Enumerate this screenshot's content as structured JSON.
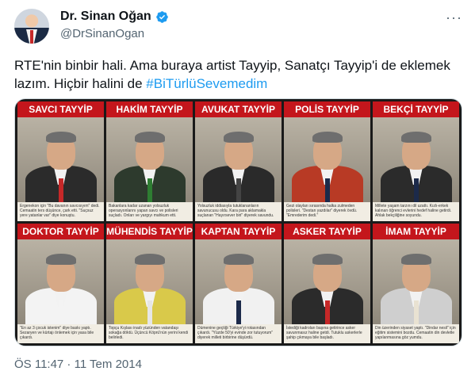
{
  "author": {
    "name": "Dr. Sinan Oğan",
    "handle": "@DrSinanOgan",
    "verified": true
  },
  "tweet": {
    "text": "RTE'nin binbir hali. Ama buraya artist Tayyip, Sanatçı Tayyip'i de eklemek lazım. Hiçbir halini de ",
    "hashtag": "#BiTürlüSevemedim",
    "timestamp": "ÖS 11:47 · 11 Tem 2014"
  },
  "media": {
    "panels": [
      {
        "label": "SAVCI TAYYİP",
        "caption": "Ergenekon için \"Bu davanın savcısıyım\" dedi. Cemaatin ters düşünce, çark etti. \"Suçsuz yere yatanlar var\" diye konuştu.",
        "body": "#2b2b2b",
        "accent": "#c62828"
      },
      {
        "label": "HAKİM TAYYİP",
        "caption": "Bakanlara kadar uzanan yolsuzluk operasyonlarını yapan savcı ve polisleri suçladı. Onları ve yargıyı mahkum etti.",
        "body": "#2d3a2d",
        "accent": "#2e7d32"
      },
      {
        "label": "AVUKAT TAYYİP",
        "caption": "Yolsuzluk iddiasıyla tutuklananların savunucusu oldu. Kara para aklamakla suçlanan \"Hayırsever biri\" diyerek savundu.",
        "body": "#2a2a2a",
        "accent": "#444444"
      },
      {
        "label": "POLİS TAYYİP",
        "caption": "Gezi olayları sırasında halka zulmeden polisleri. \"Destan yazdılar\" diyerek övdü. \"Emrederim dedi.\"",
        "body": "#b83a25",
        "accent": "#1c2a4a"
      },
      {
        "label": "BEKÇİ TAYYİP",
        "caption": "Millete yaşam tarzını dil uzattı. Kızlı-erkek kalınan öğrenci evlerini hedef haline getirdi. Ahlak bekçiliğine soyundu.",
        "body": "#2b2b2b",
        "accent": "#1c2a4a"
      },
      {
        "label": "DOKTOR TAYYİP",
        "caption": "\"En az 3 çocuk istenim\" diye baskı yaptı. Sezaryen ve kürtajı önlemek için yasa bile çıkardı.",
        "body": "#f3f3f3",
        "accent": "#f3f3f3"
      },
      {
        "label": "MÜHENDİS TAYYİP",
        "caption": "Topçu Kışlası inadı yüzünden vatandaşı sokağa döktü. Üçüncü Köprü'nün yerini kendi belirledi.",
        "body": "#d9c94a",
        "accent": "#e6e6e6"
      },
      {
        "label": "KAPTAN TAYYİP",
        "caption": "Dümenine geçtiği Türkiye'yi rotasından çıkardı. \"Yüzde 50'yi evinde zor tutuyorum\" diyerek milleti birbirine düşürdü.",
        "body": "#f1f1f1",
        "accent": "#1c2a4a"
      },
      {
        "label": "ASKER TAYYİP",
        "caption": "İstediği kadroları başına getirince asker savunmasız haline getdi. Tutuklu askerlerle şahip çıkmaya bile başladı.",
        "body": "#2b2b2b",
        "accent": "#c62828"
      },
      {
        "label": "İMAM TAYYİP",
        "caption": "Din üzerinden siyaset yaptı. \"Dindar nesil\" için eğitim sistemini bozdu. Cemaatin din devletle yapılanmasına göz yumdu.",
        "body": "#cfcfcf",
        "accent": "#e9e2d2"
      }
    ]
  },
  "colors": {
    "accent": "#1d9bf0",
    "label_red": "#c4161c",
    "muted": "#536471"
  },
  "icons": {
    "verified": "verified-badge-icon",
    "more": "more-options-icon"
  }
}
